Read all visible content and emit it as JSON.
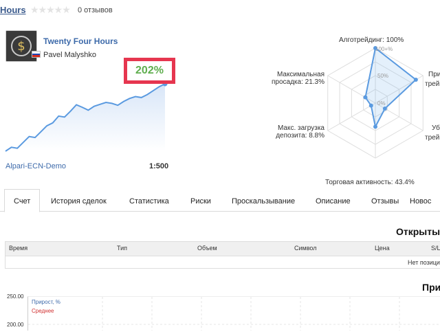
{
  "top": {
    "title": "Hours",
    "stars": "★★★★★",
    "reviews": "0 отзывов"
  },
  "signal": {
    "name": "Twenty Four Hours",
    "author": "Pavel Malyshko",
    "growth": "202%",
    "broker": "Alpari-ECN-Demo",
    "leverage": "1:500"
  },
  "sparkline": [
    0,
    8,
    6,
    18,
    30,
    28,
    40,
    52,
    58,
    72,
    70,
    82,
    95,
    90,
    84,
    92,
    96,
    100,
    98,
    94,
    102,
    108,
    112,
    110,
    116,
    124,
    132,
    138
  ],
  "radar": {
    "labels": {
      "algo": "Алготрейдинг: 100%",
      "profit_trades": "Прибыльные\nтрейды: ...",
      "loss_trades": "Убыточные\nтрейды: ...",
      "activity": "Торговая активность: 43.4%",
      "max_deposit_load": "Макс. загрузка\nдепозита: 8.8%",
      "max_drawdown": "Максимальная\nпросадка: 21.3%"
    },
    "right_top_label": "При",
    "right_top_label2": "трей",
    "right_bottom_label": "Уб",
    "right_bottom_label2": "трей",
    "scale_100": "100+%",
    "scale_50": "50%",
    "scale_0": "0%",
    "values": [
      1.0,
      0.85,
      0.2,
      0.43,
      0.09,
      0.21
    ]
  },
  "tabs": [
    "Счет",
    "История сделок",
    "Статистика",
    "Риски",
    "Проскальзывание",
    "Описание",
    "Отзывы",
    "Новос"
  ],
  "open_positions": {
    "title": "Открыты",
    "columns": [
      "Время",
      "Тип",
      "Объем",
      "Символ",
      "Цена",
      "S/L"
    ],
    "empty": "Нет позици"
  },
  "growth_chart": {
    "title": "При",
    "yticks": [
      "250.00",
      "200.00"
    ],
    "legend": {
      "growth": "Прирост, %",
      "average": "Среднее"
    },
    "colors": {
      "growth": "#3d6aaa",
      "average": "#d03030"
    }
  }
}
